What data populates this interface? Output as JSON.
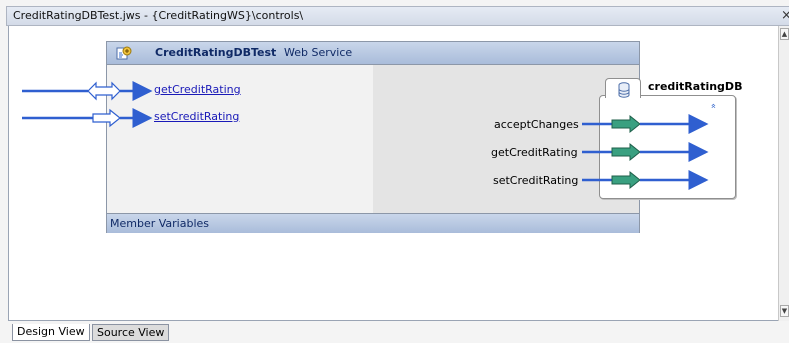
{
  "window": {
    "title": "CreditRatingDBTest.jws - {CreditRatingWS}\\controls\\",
    "close_glyph": "×"
  },
  "service": {
    "name": "CreditRatingDBTest",
    "kind": "Web Service",
    "icon": "web-service-icon",
    "operations": [
      {
        "label": "getCreditRating",
        "icon": "bidirectional-arrow-icon"
      },
      {
        "label": "setCreditRating",
        "icon": "inbound-arrow-icon"
      }
    ],
    "member_variables_label": "Member Variables"
  },
  "control": {
    "name": "creditRatingDB",
    "icon": "database-icon",
    "collapse_glyph": "»",
    "methods": [
      {
        "label": "acceptChanges"
      },
      {
        "label": "getCreditRating"
      },
      {
        "label": "setCreditRating"
      }
    ]
  },
  "tabs": [
    {
      "label": "Design View",
      "active": true
    },
    {
      "label": "Source View",
      "active": false
    }
  ],
  "colors": {
    "wire": "#2f5fd0",
    "header_bg": "#b8c9e4",
    "arrow_fill": "#3aa080"
  }
}
